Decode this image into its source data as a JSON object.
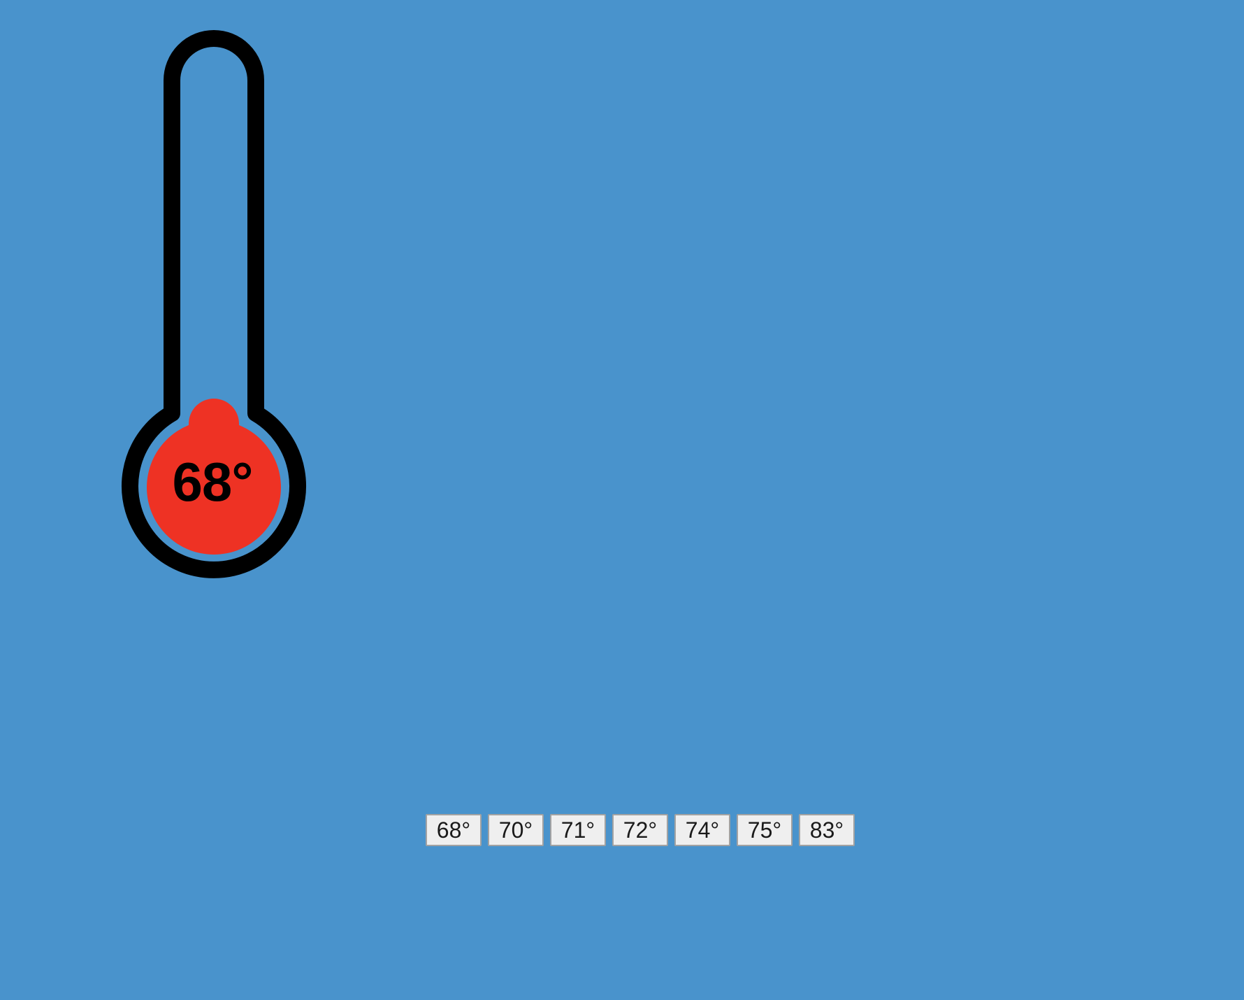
{
  "thermometer": {
    "current_temperature": "68°",
    "current_value": 68,
    "fill_level": 0,
    "fill_color": "#ee3224",
    "outline_color": "#000000",
    "background_color": "#4993cc"
  },
  "temperature_buttons": [
    {
      "label": "68°",
      "value": 68
    },
    {
      "label": "70°",
      "value": 70
    },
    {
      "label": "71°",
      "value": 71
    },
    {
      "label": "72°",
      "value": 72
    },
    {
      "label": "74°",
      "value": 74
    },
    {
      "label": "75°",
      "value": 75
    },
    {
      "label": "83°",
      "value": 83
    }
  ]
}
